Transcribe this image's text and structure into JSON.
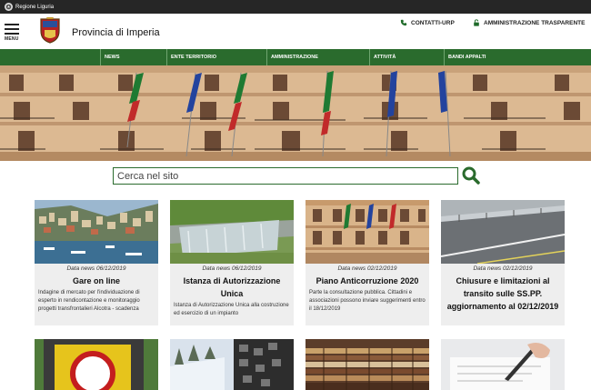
{
  "topbar": {
    "region": "Regione Liguria"
  },
  "header": {
    "menu_label": "MENU",
    "site_title": "Provincia di Imperia",
    "contatti": "CONTATTI-URP",
    "amministrazione": "AMMINISTRAZIONE TRASPARENTE"
  },
  "nav": {
    "items": [
      {
        "label": "NEWS"
      },
      {
        "label": "ENTE TERRITORIO"
      },
      {
        "label": "AMMINISTRAZIONE"
      },
      {
        "label": "ATTIVITÀ"
      },
      {
        "label": "BANDI APPALTI"
      }
    ]
  },
  "search": {
    "placeholder": "Cerca nel sito"
  },
  "news": [
    {
      "date": "Data news 06/12/2019",
      "title": "Gare on line",
      "desc": "Indagine di mercato per l'individuazione di esperto in rendicontazione e monitoraggio progetti transfrontalieri Alcotra - scadenza"
    },
    {
      "date": "Data news 06/12/2019",
      "title": "Istanza di Autorizzazione Unica",
      "desc": "Istanza di Autorizzazione Unica alla costruzione ed esercizio di un impianto"
    },
    {
      "date": "Data news 02/12/2019",
      "title": "Piano Anticorruzione 2020",
      "desc": "Parte la consultazione pubblica. Cittadini e associazioni possono inviare suggerimenti entro il 18/12/2019"
    },
    {
      "date": "Data news 02/12/2019",
      "title": "Chiusure e limitazioni al transito sulle SS.PP. aggiornamento al 02/12/2019",
      "desc": ""
    }
  ],
  "colors": {
    "brand_green": "#2a6b2d",
    "topbar": "#262626",
    "card_bg": "#eeeeee"
  }
}
